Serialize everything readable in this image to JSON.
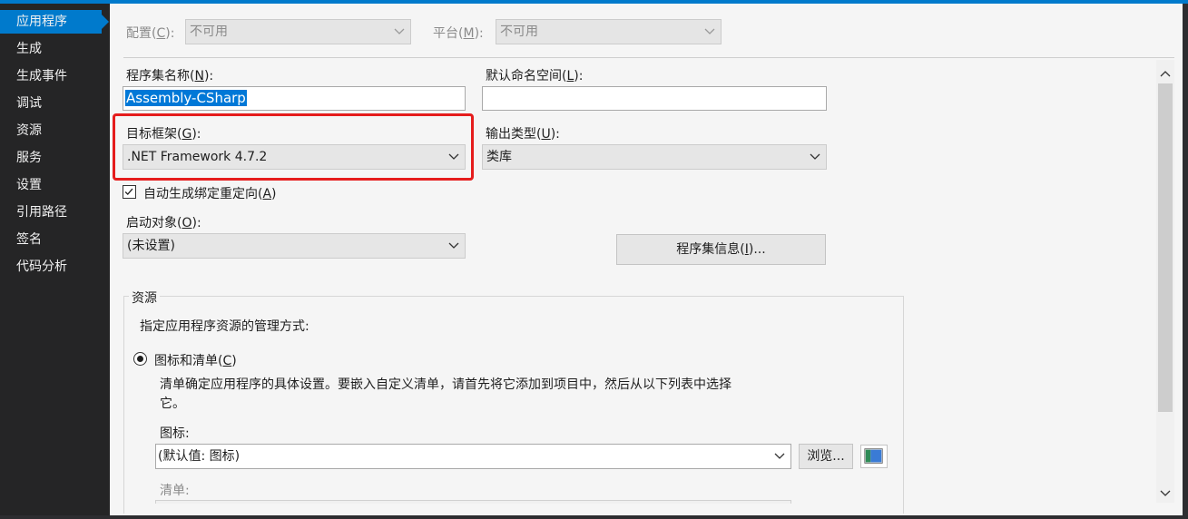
{
  "sidebar": {
    "items": [
      {
        "label": "应用程序",
        "active": true
      },
      {
        "label": "生成"
      },
      {
        "label": "生成事件"
      },
      {
        "label": "调试"
      },
      {
        "label": "资源"
      },
      {
        "label": "服务"
      },
      {
        "label": "设置"
      },
      {
        "label": "引用路径"
      },
      {
        "label": "签名"
      },
      {
        "label": "代码分析"
      }
    ]
  },
  "config": {
    "label": "配置",
    "hotkey": "C",
    "value": "不可用",
    "platform_label": "平台",
    "platform_hotkey": "M",
    "platform_value": "不可用"
  },
  "assembly": {
    "name_label": "程序集名称",
    "name_hotkey": "N",
    "name_value": "Assembly-CSharp",
    "namespace_label": "默认命名空间",
    "namespace_hotkey": "L",
    "namespace_value": ""
  },
  "framework": {
    "label": "目标框架",
    "hotkey": "G",
    "value": ".NET Framework 4.7.2",
    "output_label": "输出类型",
    "output_hotkey": "U",
    "output_value": "类库"
  },
  "auto_binding": {
    "label": "自动生成绑定重定向",
    "hotkey": "A",
    "checked": true
  },
  "startup": {
    "label": "启动对象",
    "hotkey": "O",
    "value": "(未设置)",
    "assembly_info_label": "程序集信息",
    "assembly_info_hotkey": "I",
    "assembly_info_suffix": "..."
  },
  "resources": {
    "group_title": "资源",
    "description": "指定应用程序资源的管理方式:",
    "radio_label": "图标和清单",
    "radio_hotkey": "C",
    "radio_desc_line1": "清单确定应用程序的具体设置。要嵌入自定义清单，请首先将它添加到项目中，然后从以下列表中选择",
    "radio_desc_line2": "它。",
    "icon_label": "图标:",
    "icon_value": "(默认值: 图标)",
    "browse_label": "浏览...",
    "manifest_label": "清单:"
  },
  "colors": {
    "accent": "#007acc",
    "highlight_border": "#e51c1c",
    "sidebar_bg": "#252526"
  }
}
